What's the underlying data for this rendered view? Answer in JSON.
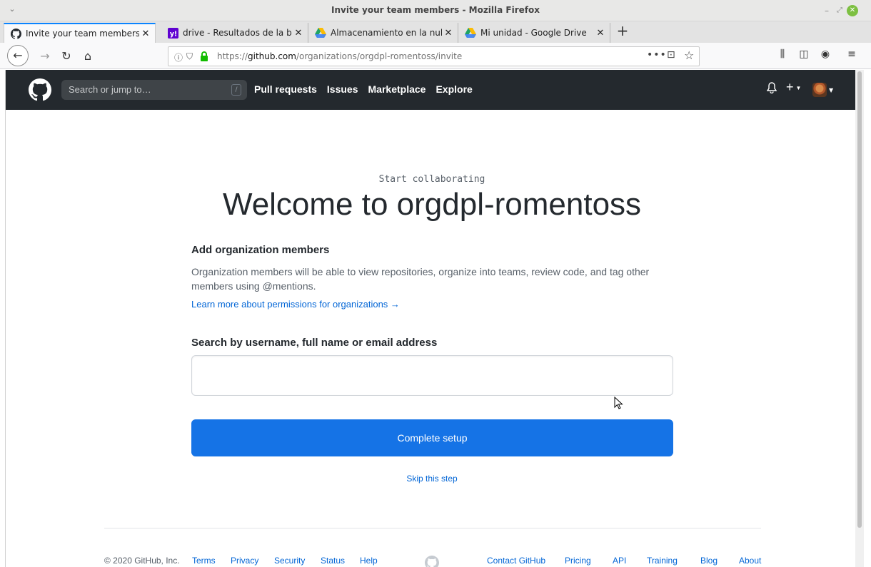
{
  "window": {
    "title": "Invite your team members - Mozilla Firefox"
  },
  "tabs": [
    {
      "label": "Invite your team members",
      "icon": "github-icon",
      "active": true
    },
    {
      "label": "drive - Resultados de la bús",
      "icon": "yahoo-icon",
      "active": false
    },
    {
      "label": "Almacenamiento en la nub",
      "icon": "google-drive-icon",
      "active": false
    },
    {
      "label": "Mi unidad - Google Drive",
      "icon": "google-drive-icon",
      "active": false
    }
  ],
  "urlbar": {
    "prefix": "https://",
    "domain": "github.com",
    "path": "/organizations/orgdpl-romentoss/invite"
  },
  "github": {
    "search_placeholder": "Search or jump to…",
    "slash_hint": "/",
    "nav": [
      "Pull requests",
      "Issues",
      "Marketplace",
      "Explore"
    ]
  },
  "page": {
    "eyebrow": "Start collaborating",
    "heading": "Welcome to orgdpl-romentoss",
    "section_title": "Add organization members",
    "section_desc": "Organization members will be able to view repositories, organize into teams, review code, and tag other members using @mentions.",
    "learn_link": "Learn more about permissions for organizations →",
    "search_label": "Search by username, full name or email address",
    "search_value": "",
    "complete_button": "Complete setup",
    "skip_link": "Skip this step"
  },
  "footer": {
    "copyright": "© 2020 GitHub, Inc.",
    "left_links": [
      "Terms",
      "Privacy",
      "Security",
      "Status",
      "Help"
    ],
    "right_links": [
      "Contact GitHub",
      "Pricing",
      "API",
      "Training",
      "Blog",
      "About"
    ]
  },
  "colors": {
    "header_bg": "#24292e",
    "primary_button": "#1573e6",
    "link": "#0366d6",
    "firefox_accent": "#0a84ff"
  }
}
